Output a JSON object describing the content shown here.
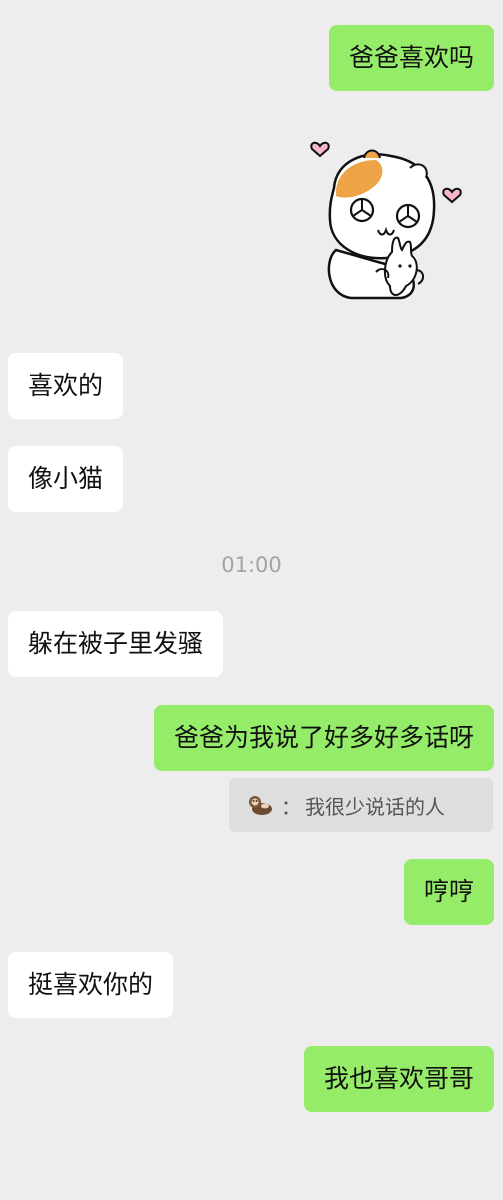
{
  "messages": [
    {
      "text": "爸爸喜欢吗"
    },
    {
      "text": "喜欢的"
    },
    {
      "text": "像小猫"
    },
    {
      "text": "躲在被子里发骚"
    },
    {
      "text": "爸爸为我说了好多好多话呀"
    },
    {
      "text": "哼哼"
    },
    {
      "text": "挺喜欢你的"
    },
    {
      "text": "我也喜欢哥哥"
    }
  ],
  "timestamp": "01:00",
  "quote": {
    "prefix": "：",
    "text": "我很少说话的人",
    "avatar_icon": "otter-emoji-icon"
  },
  "sticker": {
    "icon": "hamster-hugging-bunny-sticker"
  },
  "colors": {
    "background": "#ededed",
    "outgoing_bubble": "#95ec69",
    "incoming_bubble": "#ffffff",
    "timestamp": "#a3a3a3",
    "quote_bg": "#dedede",
    "sticker_orange": "#eea347",
    "heart_pink": "#f5b7c8"
  }
}
